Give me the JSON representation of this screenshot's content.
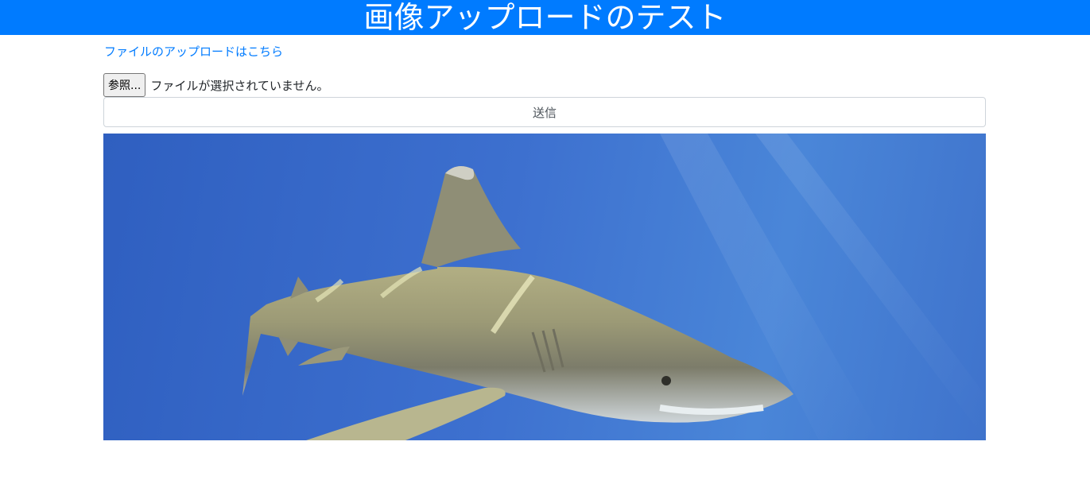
{
  "header": {
    "title": "画像アップロードのテスト"
  },
  "upload_link": {
    "label": "ファイルのアップロードはこちら"
  },
  "file_input": {
    "button_label": "参照...",
    "status": "ファイルが選択されていません。"
  },
  "submit": {
    "label": "送信"
  },
  "image": {
    "subject": "shark underwater photo"
  },
  "colors": {
    "header_bg": "#007bff",
    "link": "#007bff",
    "water": "#3d70cf",
    "shark": "#a9a77e"
  }
}
